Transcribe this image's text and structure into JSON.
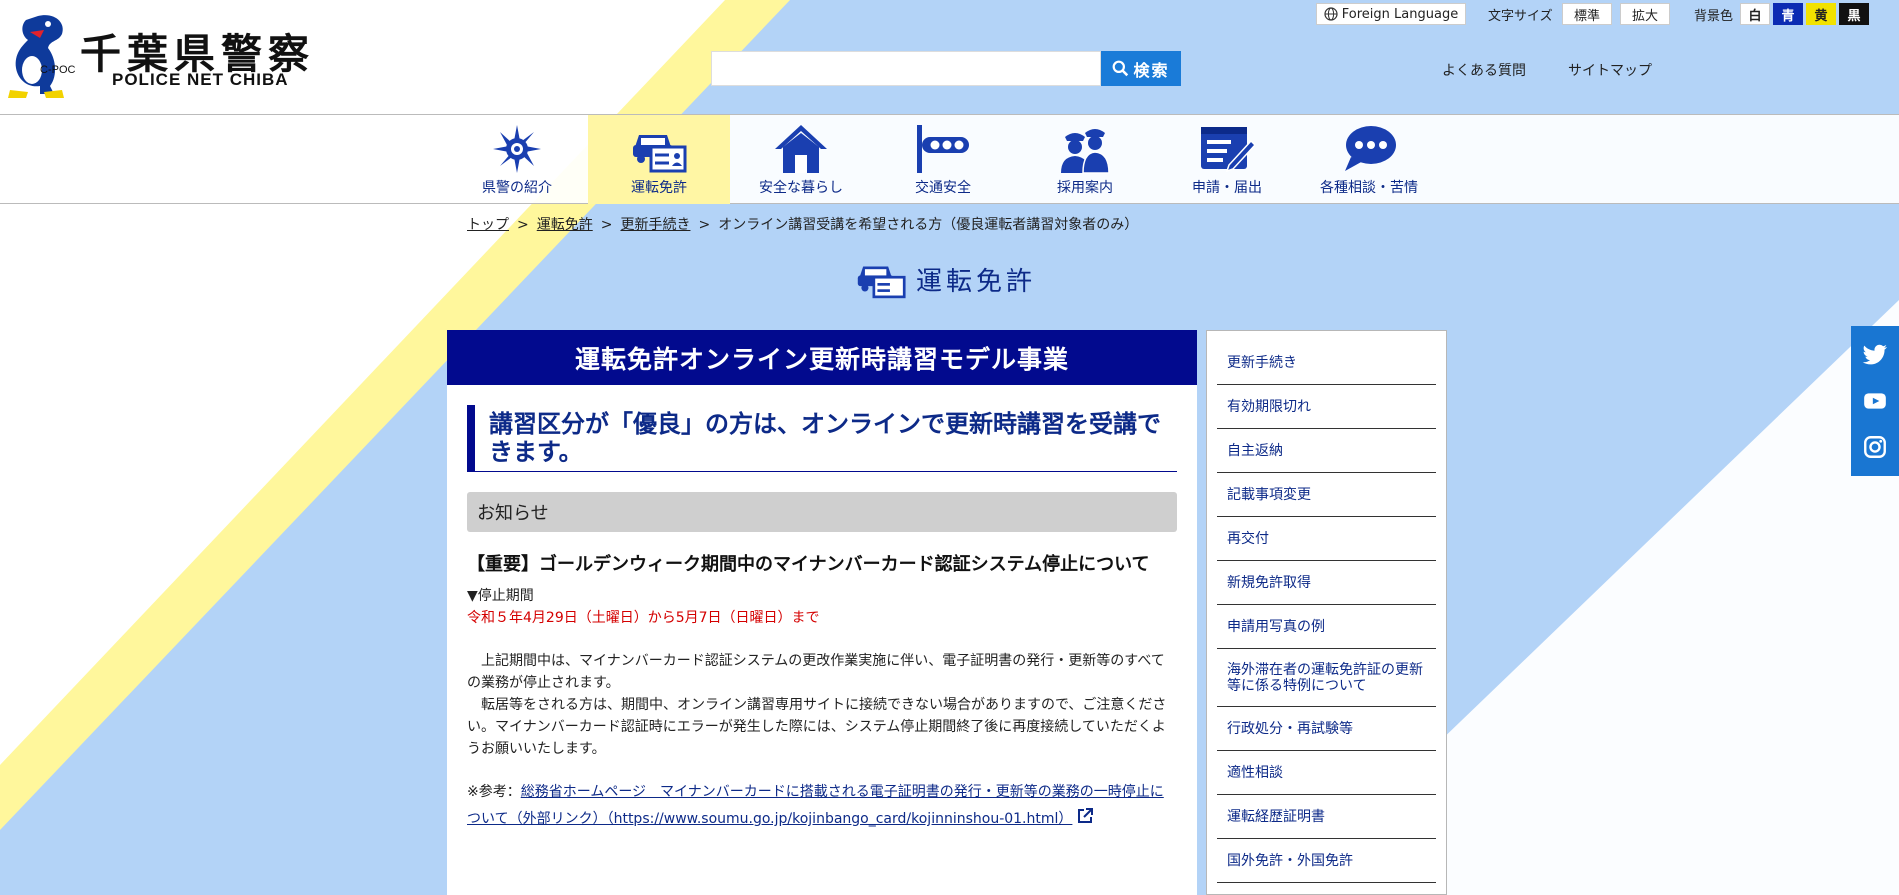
{
  "header": {
    "logo_title": "千葉県警察",
    "logo_sub": "POLICE NET CHIBA",
    "logo_cpoc": "C-POC",
    "search_button": "検索",
    "foreign_language": "Foreign Language",
    "font_size_label": "文字サイズ",
    "font_size_options": [
      "標準",
      "拡大"
    ],
    "bg_color_label": "背景色",
    "bg_color_options": [
      {
        "label": "白",
        "bg": "#ffffff",
        "fg": "#222222"
      },
      {
        "label": "青",
        "bg": "#0b2bb3",
        "fg": "#ffffff"
      },
      {
        "label": "黄",
        "bg": "#f2e200",
        "fg": "#222222"
      },
      {
        "label": "黒",
        "bg": "#111111",
        "fg": "#ffffff"
      }
    ],
    "faq": "よくある質問",
    "sitemap": "サイトマップ"
  },
  "nav": [
    {
      "label": "県警の紹介",
      "icon": "police-emblem-icon"
    },
    {
      "label": "運転免許",
      "icon": "license-card-icon",
      "active": true
    },
    {
      "label": "安全な暮らし",
      "icon": "house-icon"
    },
    {
      "label": "交通安全",
      "icon": "traffic-signal-icon"
    },
    {
      "label": "採用案内",
      "icon": "officers-icon"
    },
    {
      "label": "申請・届出",
      "icon": "form-pen-icon"
    },
    {
      "label": "各種相談・苦情",
      "icon": "speech-bubble-icon"
    }
  ],
  "breadcrumb": {
    "items": [
      "トップ",
      "運転免許",
      "更新手続き"
    ],
    "current": "オンライン講習受講を希望される方（優良運転者講習対象者のみ）",
    "separator": ">"
  },
  "section_title": "運転免許",
  "main": {
    "header": "運転免許オンライン更新時講習モデル事業",
    "lead": "講習区分が「優良」の方は、オンラインで更新時講習を受講できます。",
    "notice_title": "お知らせ",
    "notice_heading": "【重要】ゴールデンウィーク期間中のマイナンバーカード認証システム停止について",
    "period_label": "▼停止期間",
    "period_value": "令和５年4月29日（土曜日）から5月7日（日曜日）まで",
    "para1": "上記期間中は、マイナンバーカード認証システムの更改作業実施に伴い、電子証明書の発行・更新等のすべての業務が停止されます。",
    "para2": "転居等をされる方は、期間中、オンライン講習専用サイトに接続できない場合がありますので、ご注意ください。マイナンバーカード認証時にエラーが発生した際には、システム停止期間終了後に再度接続していただくようお願いいたします。",
    "ref_prefix": "※参考：",
    "ref_link": "総務省ホームページ　マイナンバーカードに搭載される電子証明書の発行・更新等の業務の一時停止について（外部リンク）（https://www.soumu.go.jp/kojinbango_card/kojinninshou-01.html）"
  },
  "sidemenu": [
    "更新手続き",
    "有効期限切れ",
    "自主返納",
    "記載事項変更",
    "再交付",
    "新規免許取得",
    "申請用写真の例",
    "海外滞在者の運転免許証の更新等に係る特例について",
    "行政処分・再試験等",
    "適性相談",
    "運転経歴証明書",
    "国外免許・外国免許"
  ],
  "social": [
    "twitter-icon",
    "youtube-icon",
    "instagram-icon"
  ],
  "colors": {
    "bg_blue": "#b3d3f7",
    "stripe_yellow": "#fff79c",
    "nav_active": "#fff6a4",
    "main_header": "#020a8e",
    "search_btn": "#1a7bd8",
    "social_bg": "#1976d2",
    "alert_red": "#d40000"
  }
}
